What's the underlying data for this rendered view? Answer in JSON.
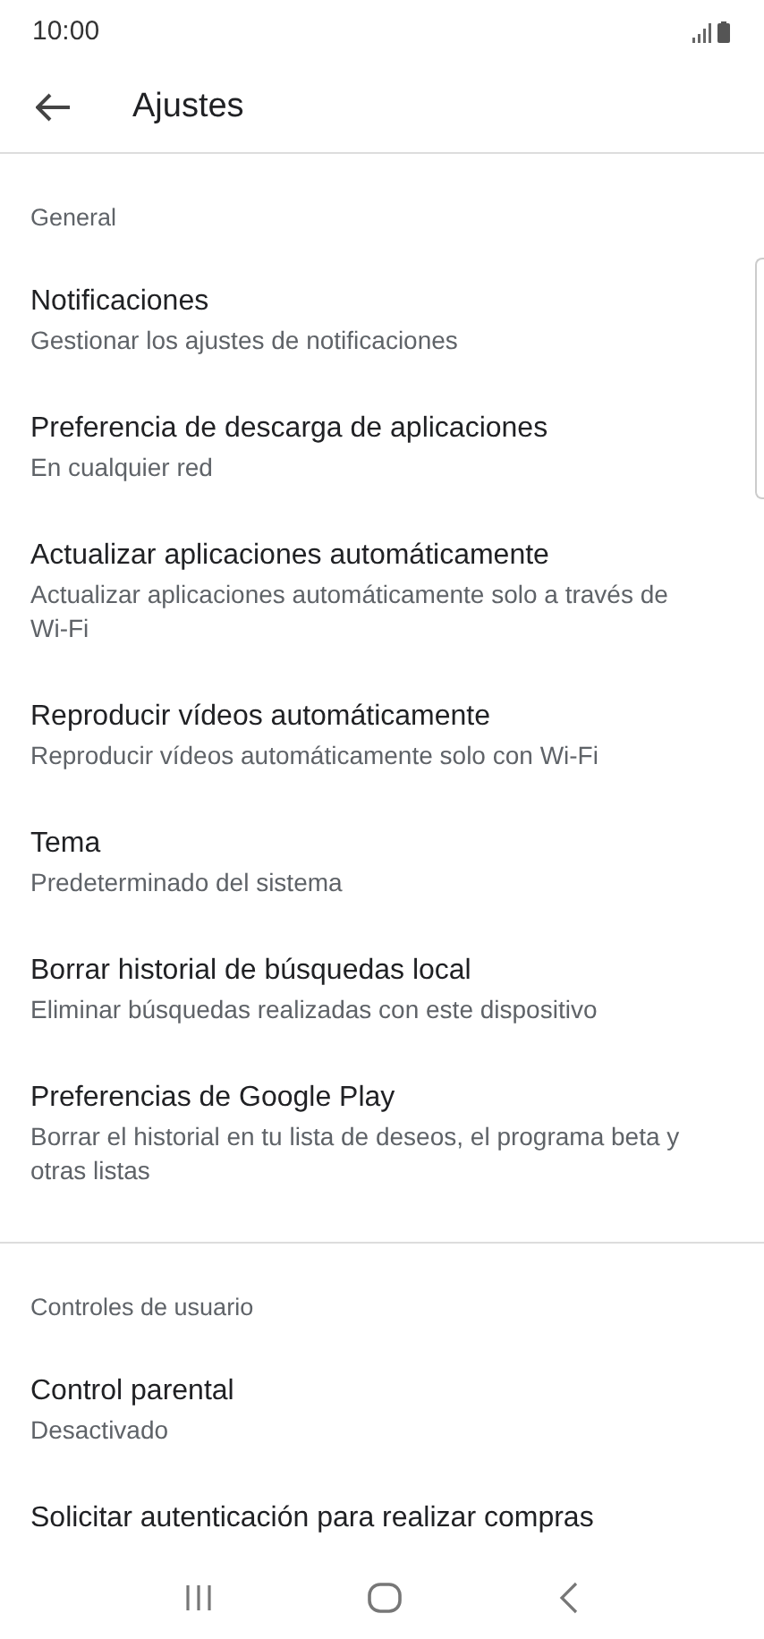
{
  "status_bar": {
    "time": "10:00"
  },
  "header": {
    "title": "Ajustes"
  },
  "sections": [
    {
      "title": "General",
      "items": [
        {
          "title": "Notificaciones",
          "subtitle": "Gestionar los ajustes de notificaciones"
        },
        {
          "title": "Preferencia de descarga de aplicaciones",
          "subtitle": "En cualquier red"
        },
        {
          "title": "Actualizar aplicaciones automáticamente",
          "subtitle": "Actualizar aplicaciones automáticamente solo a través de Wi-Fi"
        },
        {
          "title": "Reproducir vídeos automáticamente",
          "subtitle": "Reproducir vídeos automáticamente solo con Wi-Fi"
        },
        {
          "title": "Tema",
          "subtitle": "Predeterminado del sistema"
        },
        {
          "title": "Borrar historial de búsquedas local",
          "subtitle": "Eliminar búsquedas realizadas con este dispositivo"
        },
        {
          "title": "Preferencias de Google Play",
          "subtitle": "Borrar el historial en tu lista de deseos, el programa beta y otras listas"
        }
      ]
    },
    {
      "title": "Controles de usuario",
      "items": [
        {
          "title": "Control parental",
          "subtitle": "Desactivado"
        },
        {
          "title": "Solicitar autenticación para realizar compras"
        }
      ]
    }
  ]
}
